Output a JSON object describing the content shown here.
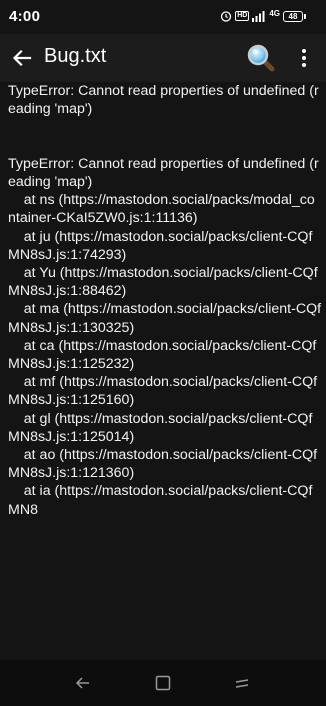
{
  "status_bar": {
    "time": "4:00",
    "network_label": "HD",
    "network_type": "4G",
    "battery": "48",
    "icons": [
      "alarm-icon",
      "hd-icon",
      "signal-icon",
      "network-4g-icon",
      "battery-icon"
    ]
  },
  "app_bar": {
    "title": "Bug.txt",
    "back_icon": "arrow-left-icon",
    "search_icon": "search-magnifier-icon",
    "menu_icon": "more-vert-icon"
  },
  "file_content": "TypeError: Cannot read properties of undefined (reading 'map')\n\n\nTypeError: Cannot read properties of undefined (reading 'map')\n    at ns (https://mastodon.social/packs/modal_container-CKaI5ZW0.js:1:11136)\n    at ju (https://mastodon.social/packs/client-CQfMN8sJ.js:1:74293)\n    at Yu (https://mastodon.social/packs/client-CQfMN8sJ.js:1:88462)\n    at ma (https://mastodon.social/packs/client-CQfMN8sJ.js:1:130325)\n    at ca (https://mastodon.social/packs/client-CQfMN8sJ.js:1:125232)\n    at mf (https://mastodon.social/packs/client-CQfMN8sJ.js:1:125160)\n    at gl (https://mastodon.social/packs/client-CQfMN8sJ.js:1:125014)\n    at ao (https://mastodon.social/packs/client-CQfMN8sJ.js:1:121360)\n    at ia (https://mastodon.social/packs/client-CQfMN8",
  "nav_bar": {
    "icons": [
      "back-nav-icon",
      "recents-icon",
      "home-gesture-icon"
    ]
  },
  "colors": {
    "background": "#141414",
    "app_bar": "#1c1c1c",
    "text": "#f2f2f2",
    "nav_bar": "#0d0d0d"
  }
}
